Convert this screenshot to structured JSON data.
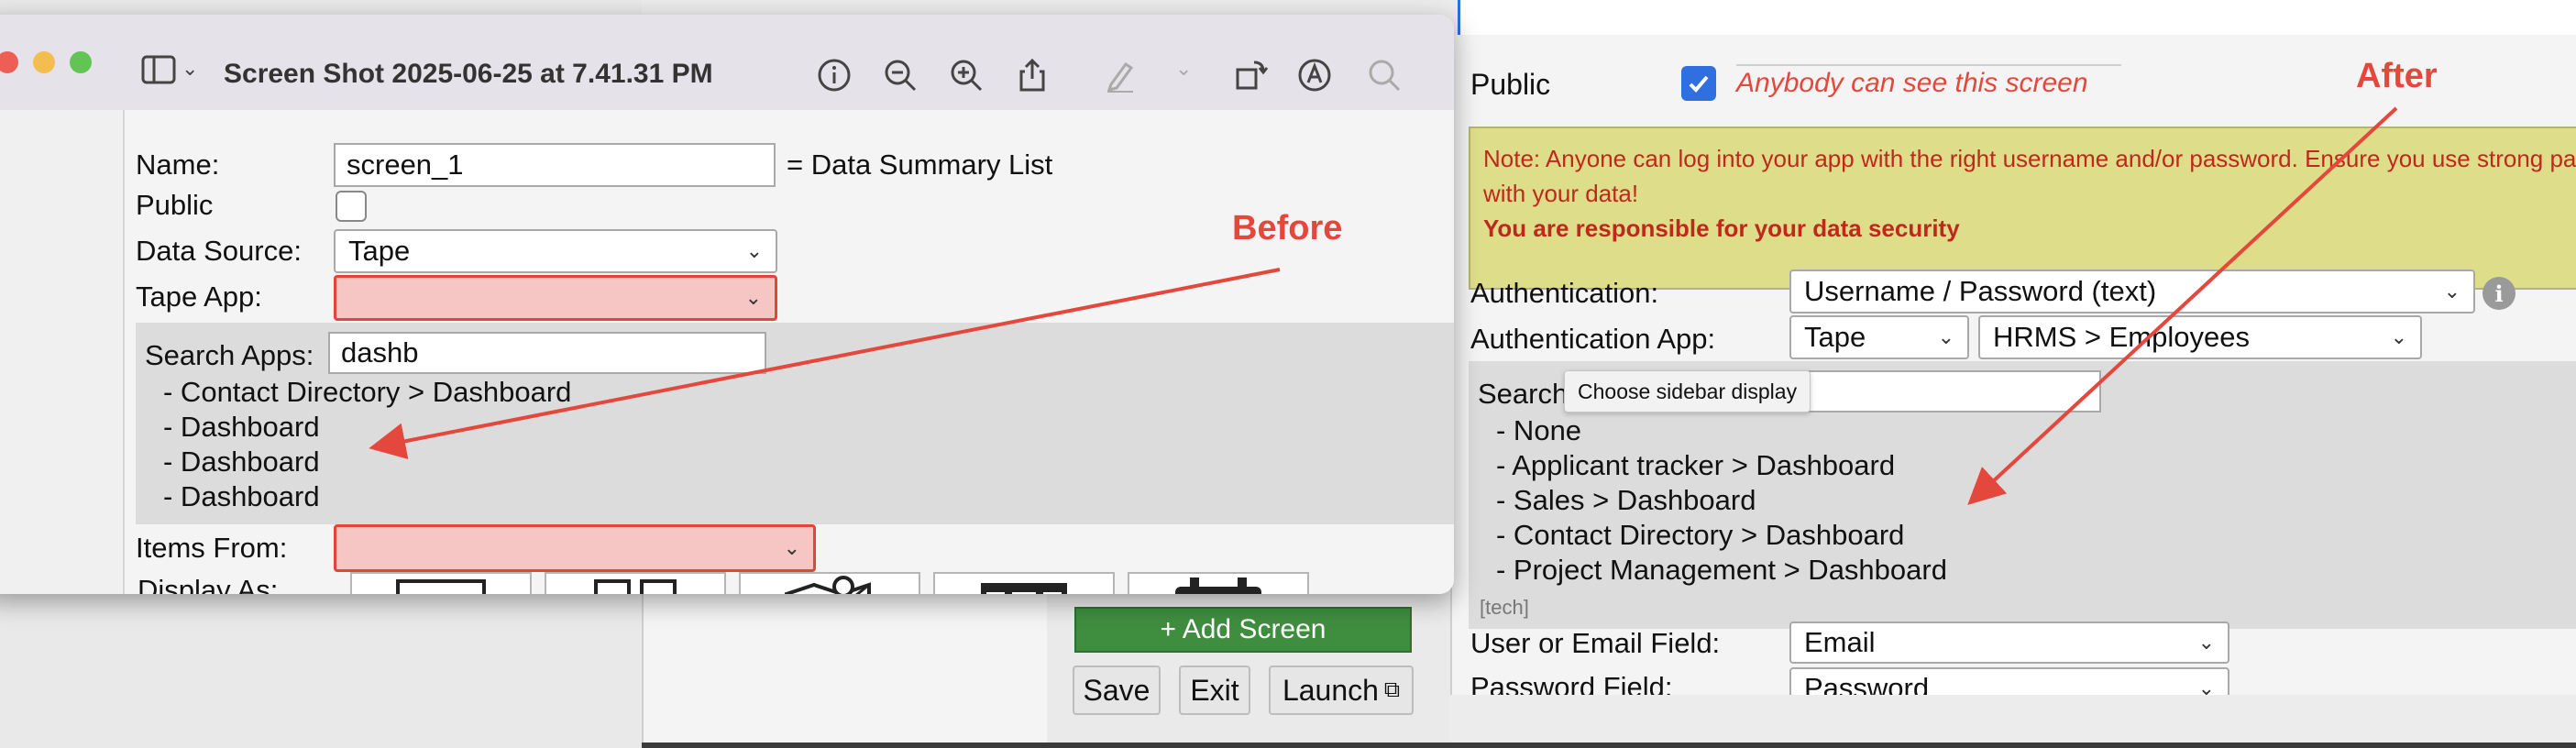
{
  "colors": {
    "accent_red": "#e4473c",
    "green_button": "#3f8d3f",
    "note_bg": "#dede8a",
    "checkbox_blue": "#2f6fe0"
  },
  "viewer": {
    "title": "Screen Shot 2025-06-25 at 7.41.31 PM",
    "icons": [
      "sidebar-icon",
      "info-icon",
      "zoom-out-icon",
      "zoom-in-icon",
      "share-icon",
      "markup-icon",
      "rotate-icon",
      "annotate-icon",
      "search-icon"
    ],
    "tooltip": "Choose sidebar display"
  },
  "before": {
    "annotation": "Before",
    "name_label": "Name:",
    "name_value": "screen_1",
    "name_suffix": "= Data Summary List",
    "public_label": "Public",
    "data_source_label": "Data Source:",
    "data_source_value": "Tape",
    "tape_app_label": "Tape App:",
    "tape_app_value": "",
    "search_apps_label": "Search Apps:",
    "search_apps_value": "dashb",
    "results": [
      "- Contact Directory > Dashboard",
      "- Dashboard",
      "- Dashboard",
      "- Dashboard"
    ],
    "items_from_label": "Items From:",
    "items_from_value": "",
    "display_as_label": "Display As:"
  },
  "after": {
    "annotation": "After",
    "public_label": "Public",
    "public_checked": true,
    "public_hint": "Anybody can see this screen",
    "note_line1": "Note: Anyone can log into your app with the right username and/or password. Ensure you use strong pass",
    "note_line2": "with your data!",
    "note_line3": "You are responsible for your data security",
    "authentication_label": "Authentication:",
    "authentication_value": "Username / Password (text)",
    "auth_app_label": "Authentication App:",
    "auth_app_source": "Tape",
    "auth_app_value": "HRMS > Employees",
    "search_label": "Search A",
    "results": [
      "- None",
      "- Applicant tracker > Dashboard",
      "- Sales > Dashboard",
      "- Contact Directory > Dashboard",
      "- Project Management > Dashboard"
    ],
    "tech_tag": "[tech]",
    "user_field_label": "User or Email Field:",
    "user_field_value": "Email",
    "password_field_label": "Password Field:",
    "password_field_value": "Password"
  },
  "bottom_bar": {
    "add_screen": "+ Add Screen",
    "save": "Save",
    "exit": "Exit",
    "launch": "Launch"
  }
}
